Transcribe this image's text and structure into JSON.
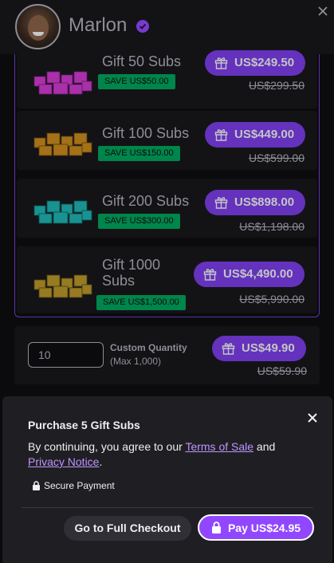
{
  "header": {
    "username": "Marlon"
  },
  "tiers": [
    {
      "name": "Gift 50 Subs",
      "save": "SAVE US$50.00",
      "price": "US$249.50",
      "old_price": "US$299.50"
    },
    {
      "name": "Gift 100 Subs",
      "save": "SAVE US$150.00",
      "price": "US$449.00",
      "old_price": "US$599.00"
    },
    {
      "name": "Gift 200 Subs",
      "save": "SAVE US$300.00",
      "price": "US$898.00",
      "old_price": "US$1,198.00"
    },
    {
      "name": "Gift 1000 Subs",
      "save": "SAVE US$1,500.00",
      "price": "US$4,490.00",
      "old_price": "US$5,990.00"
    }
  ],
  "custom": {
    "quantity_value": "10",
    "label": "Custom Quantity",
    "max": "(Max 1,000)",
    "price": "US$49.90",
    "old_price": "US$59.90"
  },
  "panel": {
    "title": "Purchase 5 Gift Subs",
    "terms_prefix": "By continuing, you agree to our ",
    "terms_link": "Terms of Sale",
    "terms_middle": " and ",
    "privacy_link": "Privacy Notice",
    "terms_suffix": ".",
    "secure": "Secure Payment",
    "checkout_label": "Go to Full Checkout",
    "pay_label": "Pay US$24.95"
  },
  "colors": {
    "accent": "#9147ff",
    "save_green": "#00a35c",
    "gifts_tier1": "#d03bd0",
    "gifts_tier2": "#c98a1e",
    "gifts_tier3": "#1fb3b3",
    "gifts_tier4": "#b8962a"
  },
  "icons": [
    "verified-badge-icon",
    "close-icon",
    "gift-icon",
    "lock-icon",
    "gift-boxes-icon"
  ]
}
